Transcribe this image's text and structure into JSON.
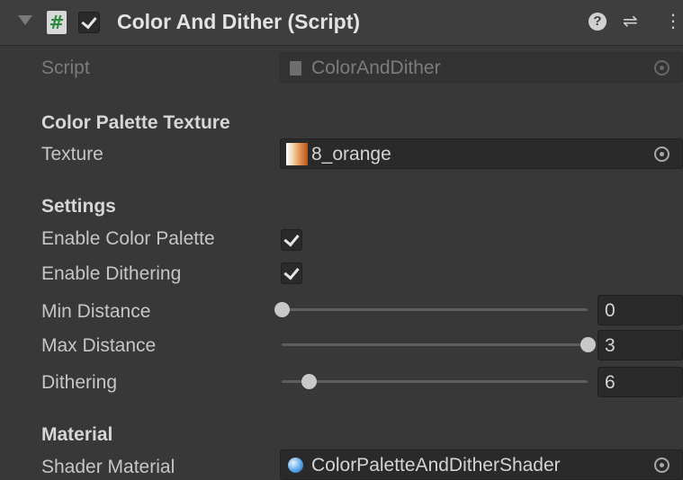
{
  "header": {
    "title": "Color And Dither (Script)",
    "script_icon_glyph": "#",
    "enabled": true,
    "icons": [
      "foldout-arrow-icon",
      "script-icon",
      "help-icon",
      "presets-icon",
      "kebab-menu-icon"
    ]
  },
  "script_row": {
    "label": "Script",
    "value": "ColorAndDither"
  },
  "color_palette_section": {
    "title": "Color Palette Texture",
    "texture_label": "Texture",
    "texture_value": "8_orange"
  },
  "settings_section": {
    "title": "Settings",
    "enable_color_palette": {
      "label": "Enable Color Palette",
      "checked": true
    },
    "enable_dithering": {
      "label": "Enable Dithering",
      "checked": true
    },
    "min_distance": {
      "label": "Min Distance",
      "value": "0",
      "fraction": 0.0
    },
    "max_distance": {
      "label": "Max Distance",
      "value": "3",
      "fraction": 1.0
    },
    "dithering": {
      "label": "Dithering",
      "value": "6",
      "fraction": 0.09
    }
  },
  "material_section": {
    "title": "Material",
    "shader_material_label": "Shader Material",
    "shader_material_value": "ColorPaletteAndDitherShader"
  },
  "colors": {
    "background": "#383838",
    "header": "#3e3e3e",
    "field": "#2a2a2a",
    "text": "#c4c4c4"
  }
}
